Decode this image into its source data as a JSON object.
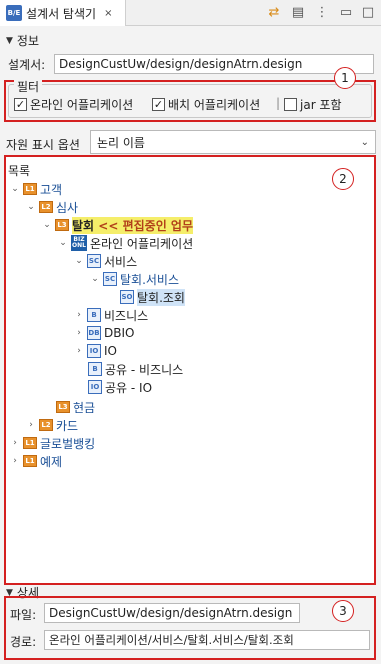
{
  "tab": {
    "title": "설계서 탐색기",
    "close": "×"
  },
  "info": {
    "title": "정보",
    "designer_label": "설계서:",
    "designer_value": "DesignCustUw/design/designAtrn.design"
  },
  "filter": {
    "title": "필터",
    "options": [
      {
        "label": "온라인 어플리케이션",
        "checked": true
      },
      {
        "label": "배치 어플리케이션",
        "checked": true
      },
      {
        "label": "jar 포함",
        "checked": false
      }
    ],
    "separator": "|"
  },
  "resource": {
    "label": "자원 표시 옵션",
    "selected": "논리 이름"
  },
  "tree": {
    "title": "목록",
    "nodes": [
      {
        "label": "고객",
        "level": "L1",
        "expanded": true
      },
      {
        "label": "심사",
        "level": "L2",
        "expanded": true
      },
      {
        "label": "탈회",
        "level": "L3",
        "expanded": true,
        "note": "<< 편집중인 업무"
      },
      {
        "label": "온라인 어플리케이션",
        "icon": "BIZ ONL",
        "expanded": true
      },
      {
        "label": "서비스",
        "icon": "SC",
        "expanded": true
      },
      {
        "label": "탈회.서비스",
        "icon": "SC",
        "expanded": true
      },
      {
        "label": "탈회.조회",
        "icon": "SO"
      },
      {
        "label": "비즈니스",
        "icon": "B",
        "expanded": false
      },
      {
        "label": "DBIO",
        "icon": "DB",
        "expanded": false
      },
      {
        "label": "IO",
        "icon": "IO",
        "expanded": false
      },
      {
        "label": "공유 - 비즈니스",
        "icon": "B"
      },
      {
        "label": "공유 - IO",
        "icon": "IO"
      },
      {
        "label": "현금",
        "level": "L3"
      },
      {
        "label": "카드",
        "level": "L2",
        "expanded": false
      },
      {
        "label": "글로벌뱅킹",
        "level": "L1",
        "expanded": false
      },
      {
        "label": "예제",
        "level": "L1",
        "expanded": false
      }
    ]
  },
  "detail": {
    "title": "상세",
    "file_label": "파일:",
    "file_value": "DesignCustUw/design/designAtrn.design",
    "path_label": "경로:",
    "path_value": "온라인 어플리케이션/서비스/탈회.서비스/탈회.조회"
  },
  "callouts": [
    "1",
    "2",
    "3"
  ],
  "colors": {
    "red": "#d42020",
    "blue_text": "#1a4f96",
    "level": "#e8912c",
    "highlight": "#f5ee6a"
  }
}
